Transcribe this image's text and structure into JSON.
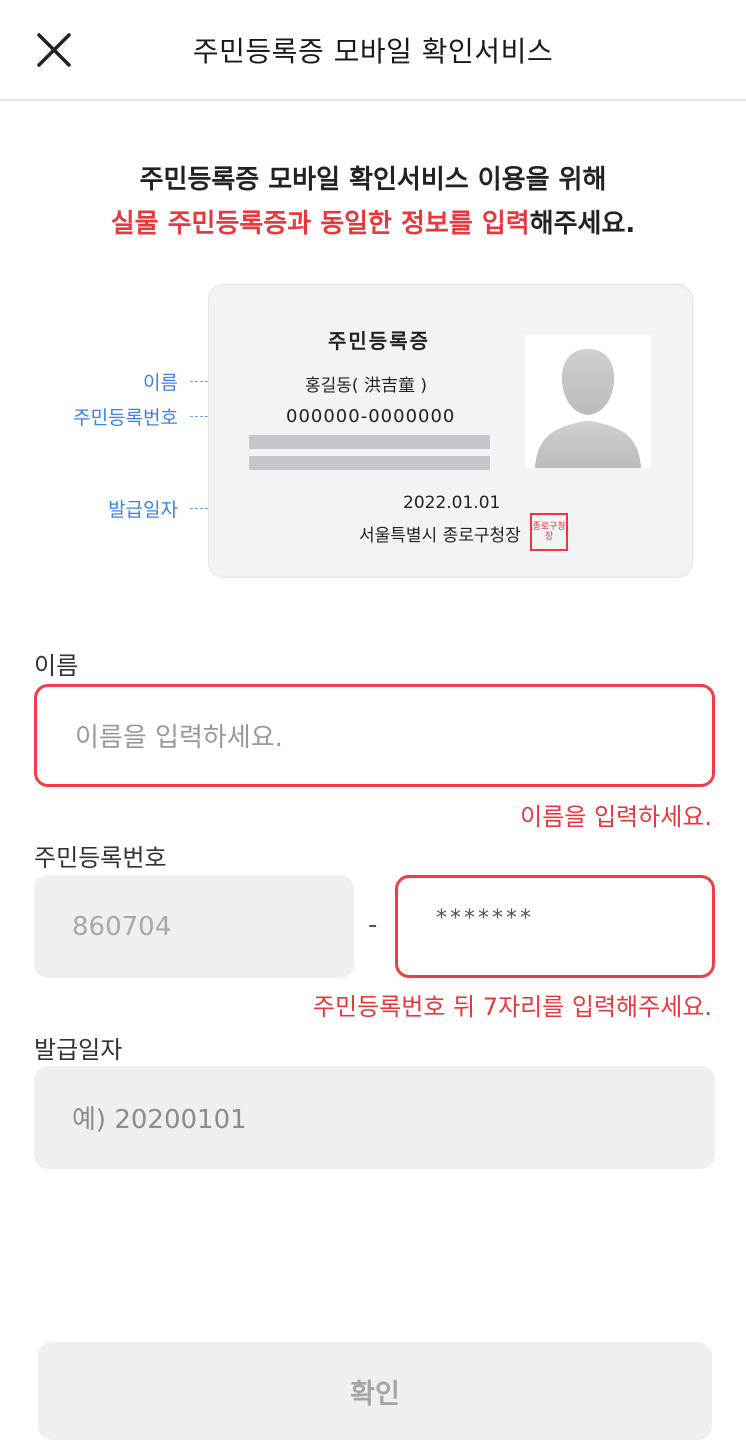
{
  "header": {
    "title": "주민등록증 모바일 확인서비스"
  },
  "intro": {
    "line1": "주민등록증 모바일 확인서비스 이용을 위해",
    "line2_highlight": "실물 주민등록증과 동일한 정보를 입력",
    "line2_rest": "해주세요."
  },
  "card": {
    "title": "주민등록증",
    "name": "홍길동( 洪吉童 )",
    "rrn": "000000-0000000",
    "issue_date": "2022.01.01",
    "issuer": "서울특별시 종로구청장",
    "seal_text": "종로구청장",
    "labels": {
      "name": "이름",
      "rrn": "주민등록번호",
      "issue_date": "발급일자"
    }
  },
  "form": {
    "name": {
      "label": "이름",
      "placeholder": "이름을 입력하세요.",
      "error": "이름을 입력하세요."
    },
    "rrn": {
      "label": "주민등록번호",
      "front_value": "860704",
      "separator": "-",
      "back_value": "*******",
      "error": "주민등록번호 뒤 7자리를 입력해주세요."
    },
    "issue_date": {
      "label": "발급일자",
      "placeholder": "예) 20200101"
    }
  },
  "confirm_button": {
    "label": "확인"
  },
  "colors": {
    "accent_red": "#e8383d",
    "label_blue": "#3b82e8",
    "disabled_gray": "#eeeff2"
  }
}
